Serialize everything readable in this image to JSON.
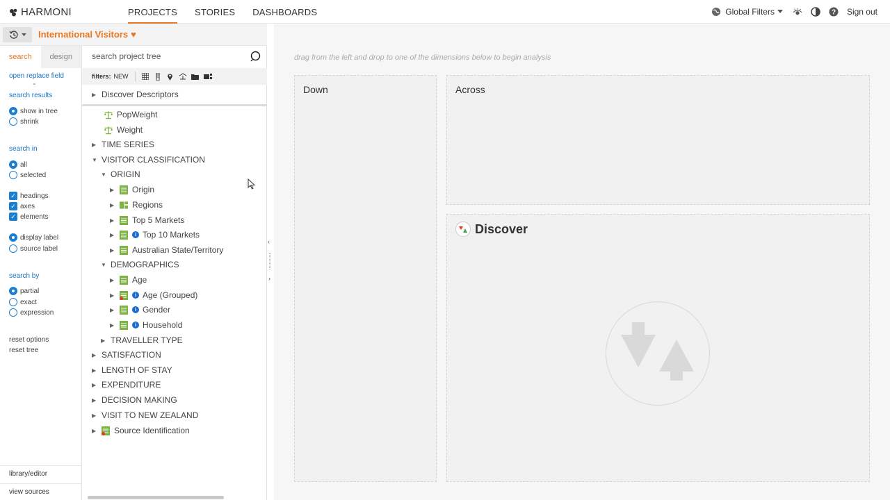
{
  "app": {
    "logo_text": "HARMONI"
  },
  "nav": {
    "items": [
      "PROJECTS",
      "STORIES",
      "DASHBOARDS"
    ],
    "active": "PROJECTS"
  },
  "topright": {
    "global_filters": "Global Filters",
    "sign_out": "Sign out"
  },
  "project": {
    "title": "International Visitors"
  },
  "left_panel": {
    "tabs": [
      "search",
      "design"
    ],
    "open_replace": "open replace field",
    "search_results_label": "search results",
    "search_results_options": [
      "show in tree",
      "shrink"
    ],
    "search_in_label": "search in",
    "search_in_options": [
      "all",
      "selected"
    ],
    "checkboxes": [
      "headings",
      "axes",
      "elements"
    ],
    "label_options": [
      "display label",
      "source label"
    ],
    "search_by_label": "search by",
    "search_by_options": [
      "partial",
      "exact",
      "expression"
    ],
    "reset_options": "reset options",
    "reset_tree": "reset tree",
    "library_editor": "library/editor",
    "view_sources": "view sources"
  },
  "tree_panel": {
    "search_placeholder": "search project tree",
    "filters_label": "filters:",
    "filters_new": "NEW",
    "nodes": [
      "Discover Descriptors",
      "PopWeight",
      "Weight",
      "TIME SERIES",
      "VISITOR CLASSIFICATION",
      "ORIGIN",
      "Origin",
      "Regions",
      "Top 5 Markets",
      "Top 10 Markets",
      "Australian State/Territory",
      "DEMOGRAPHICS",
      "Age",
      "Age (Grouped)",
      "Gender",
      "Household",
      "TRAVELLER TYPE",
      "SATISFACTION",
      "LENGTH OF STAY",
      "EXPENDITURE",
      "DECISION MAKING",
      "VISIT TO NEW ZEALAND",
      "Source Identification"
    ]
  },
  "main": {
    "hint": "drag from the left and drop to one of the dimensions below to begin analysis",
    "down_label": "Down",
    "across_label": "Across",
    "discover_label": "Discover"
  },
  "colors": {
    "accent": "#e87722",
    "link": "#1a73c5",
    "tree_icon": "#7cb342"
  }
}
